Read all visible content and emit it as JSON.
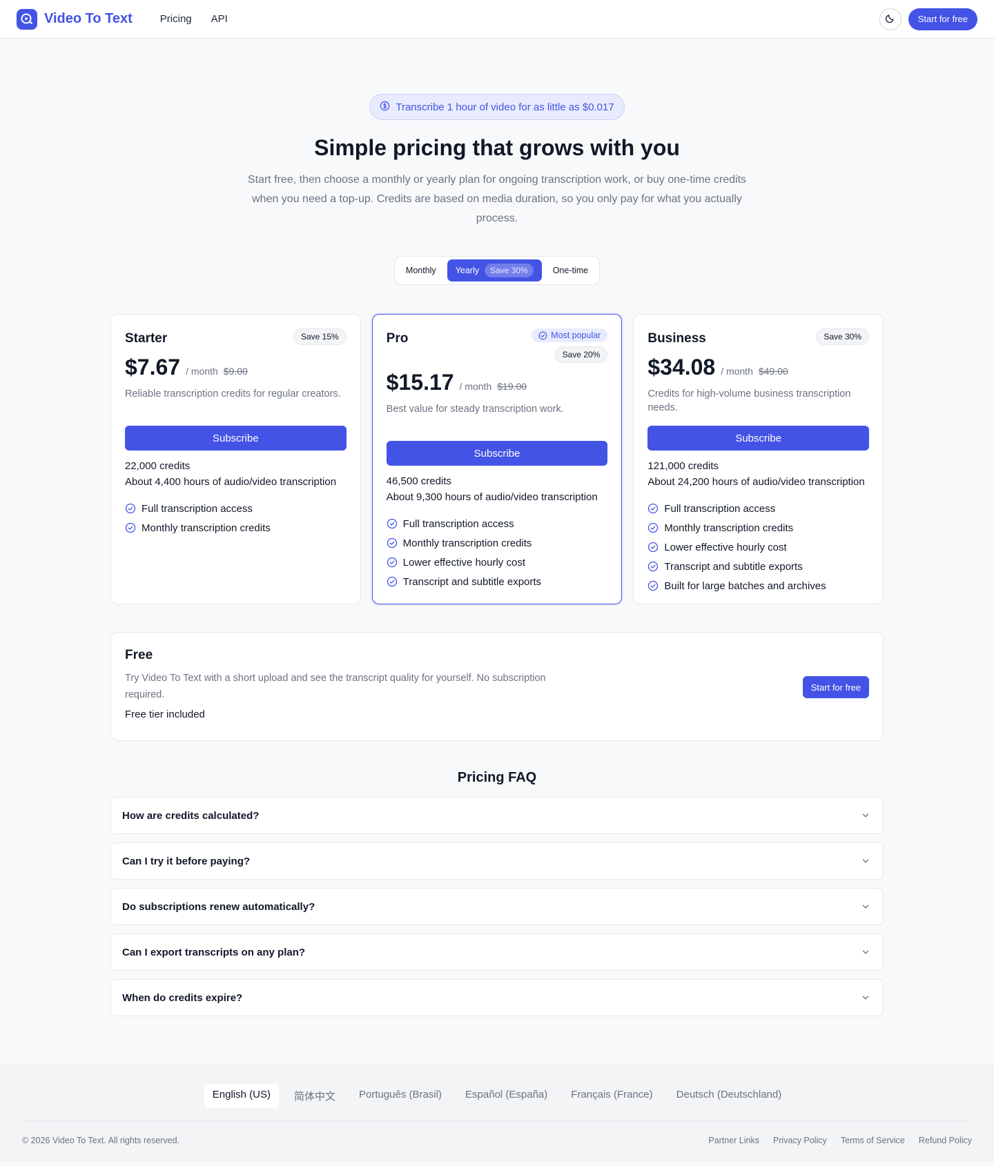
{
  "header": {
    "brand": "Video To Text",
    "nav": [
      "Pricing",
      "API"
    ],
    "cta": "Start for free",
    "icons": {
      "logo": "play-logo-icon",
      "theme": "moon-icon"
    }
  },
  "hero": {
    "promo": "Transcribe 1 hour of video for as little as $0.017",
    "title": "Simple pricing that grows with you",
    "subtitle": "Start free, then choose a monthly or yearly plan for ongoing transcription work, or buy one-time credits when you need a top-up. Credits are based on media duration, so you only pay for what you actually process."
  },
  "billing_toggle": {
    "monthly": "Monthly",
    "yearly": "Yearly",
    "yearly_badge": "Save 30%",
    "onetime": "One-time",
    "selected": "Yearly"
  },
  "plans": [
    {
      "name": "Starter",
      "save": "Save 15%",
      "price": "$7.67",
      "period": "/ month",
      "old_price": "$9.00",
      "description": "Reliable transcription credits for regular creators.",
      "button": "Subscribe",
      "credits_num": "22,000",
      "credits_word": "credits",
      "hours": "About 4,400 hours of audio/video transcription",
      "features": [
        "Full transcription access",
        "Monthly transcription credits"
      ]
    },
    {
      "name": "Pro",
      "popular": "Most popular",
      "save": "Save 20%",
      "price": "$15.17",
      "period": "/ month",
      "old_price": "$19.00",
      "description": "Best value for steady transcription work.",
      "button": "Subscribe",
      "credits_num": "46,500",
      "credits_word": "credits",
      "hours": "About 9,300 hours of audio/video transcription",
      "features": [
        "Full transcription access",
        "Monthly transcription credits",
        "Lower effective hourly cost",
        "Transcript and subtitle exports"
      ]
    },
    {
      "name": "Business",
      "save": "Save 30%",
      "price": "$34.08",
      "period": "/ month",
      "old_price": "$49.00",
      "description": "Credits for high-volume business transcription needs.",
      "button": "Subscribe",
      "credits_num": "121,000",
      "credits_word": "credits",
      "hours": "About 24,200 hours of audio/video transcription",
      "features": [
        "Full transcription access",
        "Monthly transcription credits",
        "Lower effective hourly cost",
        "Transcript and subtitle exports",
        "Built for large batches and archives"
      ]
    }
  ],
  "free": {
    "title": "Free",
    "description": "Try Video To Text with a short upload and see the transcript quality for yourself. No subscription required.",
    "note": "Free tier included",
    "button": "Start for free"
  },
  "faq": {
    "title": "Pricing FAQ",
    "items": [
      "How are credits calculated?",
      "Can I try it before paying?",
      "Do subscriptions renew automatically?",
      "Can I export transcripts on any plan?",
      "When do credits expire?"
    ]
  },
  "footer": {
    "languages": [
      "English (US)",
      "简体中文",
      "Português (Brasil)",
      "Español (España)",
      "Français (France)",
      "Deutsch (Deutschland)"
    ],
    "current_language": "English (US)",
    "copyright": "© 2026 Video To Text. All rights reserved.",
    "links": [
      "Partner Links",
      "Privacy Policy",
      "Terms of Service",
      "Refund Policy"
    ]
  },
  "colors": {
    "accent": "#4353e6",
    "accent_soft": "#e8ebfd",
    "text_muted": "#6b7280"
  }
}
